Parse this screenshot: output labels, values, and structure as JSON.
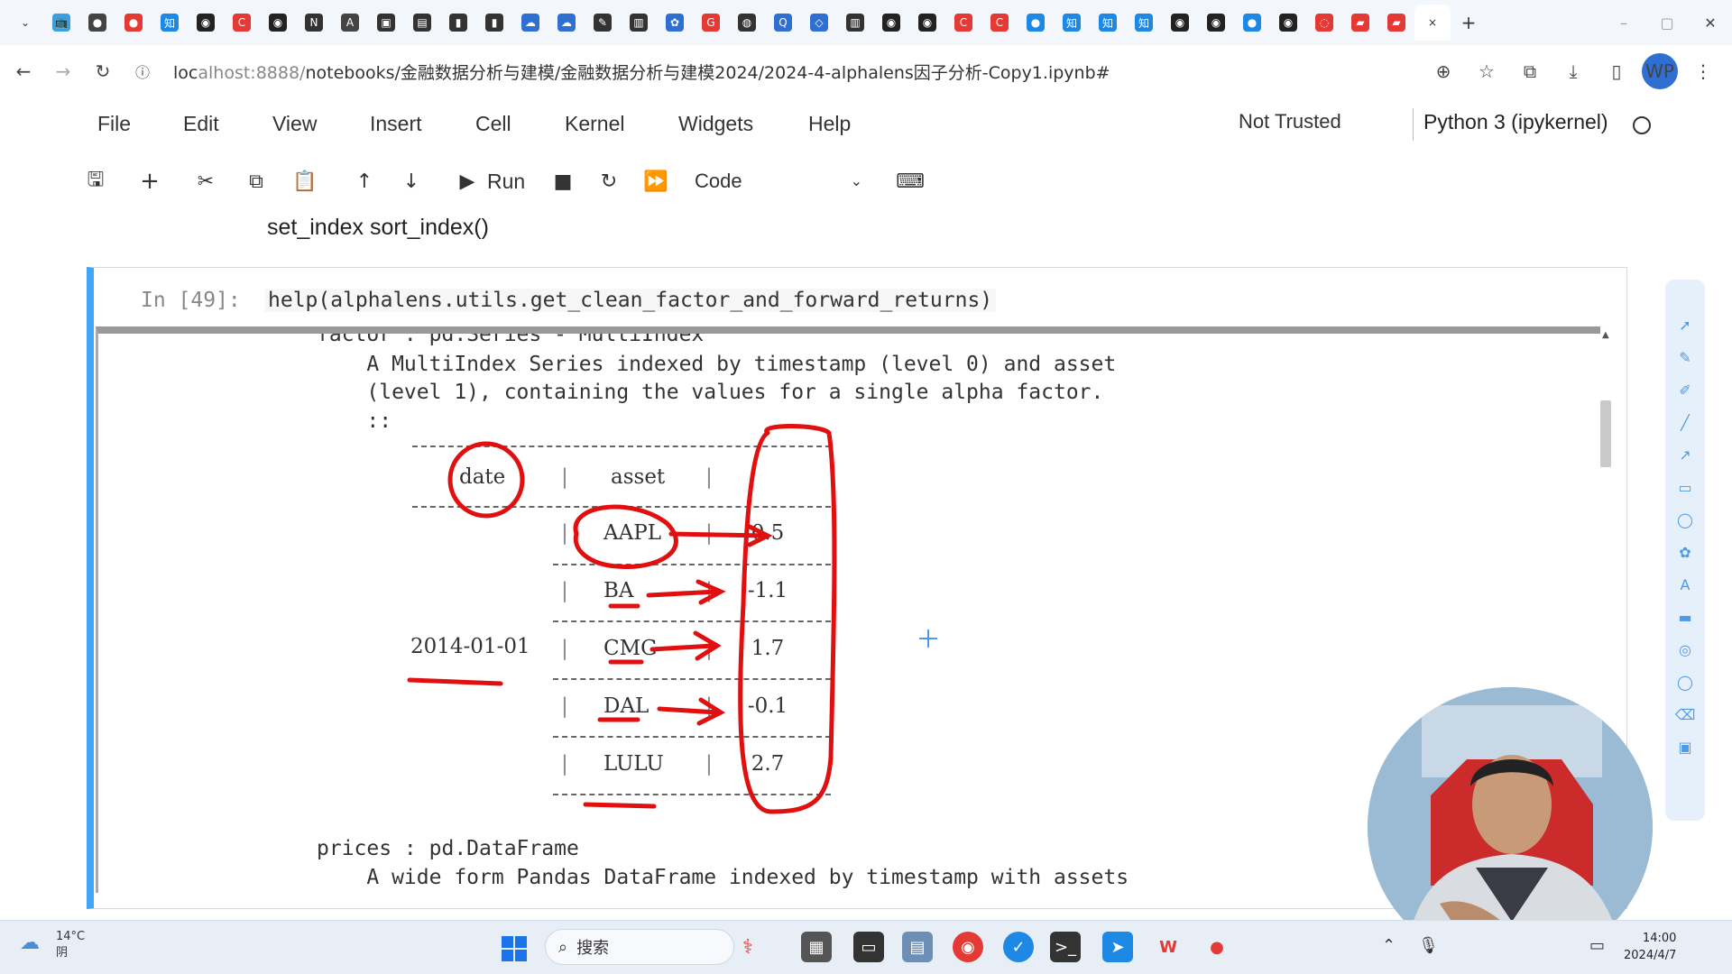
{
  "browser": {
    "tabs": [
      {
        "icon": "bilibili-icon",
        "glyph": "📺",
        "color": "#3b9ede"
      },
      {
        "icon": "chat-icon",
        "glyph": "●",
        "color": "#444444"
      },
      {
        "icon": "record-icon",
        "glyph": "●",
        "color": "#e53935"
      },
      {
        "icon": "zhihu-icon",
        "glyph": "知",
        "color": "#1e88e5"
      },
      {
        "icon": "github-icon",
        "glyph": "◉",
        "color": "#222222"
      },
      {
        "icon": "c-icon",
        "glyph": "C",
        "color": "#e53935"
      },
      {
        "icon": "github-icon",
        "glyph": "◉",
        "color": "#222222"
      },
      {
        "icon": "notion-icon",
        "glyph": "N",
        "color": "#333333"
      },
      {
        "icon": "ai-icon",
        "glyph": "A",
        "color": "#444444"
      },
      {
        "icon": "video-icon",
        "glyph": "▣",
        "color": "#333333"
      },
      {
        "icon": "doc-icon",
        "glyph": "▤",
        "color": "#333333"
      },
      {
        "icon": "terminal-icon",
        "glyph": "▮",
        "color": "#333333"
      },
      {
        "icon": "terminal-icon",
        "glyph": "▮",
        "color": "#333333"
      },
      {
        "icon": "cloud-icon",
        "glyph": "☁",
        "color": "#2f6fd1"
      },
      {
        "icon": "cloud-icon",
        "glyph": "☁",
        "color": "#2f6fd1"
      },
      {
        "icon": "python-icon",
        "glyph": "✎",
        "color": "#333333"
      },
      {
        "icon": "book-icon",
        "glyph": "▥",
        "color": "#333333"
      },
      {
        "icon": "paw-icon",
        "glyph": "✿",
        "color": "#2f6fd1"
      },
      {
        "icon": "google-icon",
        "glyph": "G",
        "color": "#e53935"
      },
      {
        "icon": "globe-icon",
        "glyph": "◍",
        "color": "#333333"
      },
      {
        "icon": "q-icon",
        "glyph": "Q",
        "color": "#2f6fd1"
      },
      {
        "icon": "vscode-icon",
        "glyph": "◇",
        "color": "#2f6fd1"
      },
      {
        "icon": "book-icon",
        "glyph": "▥",
        "color": "#333333"
      },
      {
        "icon": "github-icon",
        "glyph": "◉",
        "color": "#222222"
      },
      {
        "icon": "github-icon",
        "glyph": "◉",
        "color": "#222222"
      },
      {
        "icon": "c-icon",
        "glyph": "C",
        "color": "#e53935"
      },
      {
        "icon": "c-icon",
        "glyph": "C",
        "color": "#e53935"
      },
      {
        "icon": "circle-icon",
        "glyph": "●",
        "color": "#1e88e5"
      },
      {
        "icon": "zhihu-icon",
        "glyph": "知",
        "color": "#1e88e5"
      },
      {
        "icon": "zhihu-icon",
        "glyph": "知",
        "color": "#1e88e5"
      },
      {
        "icon": "zhihu-icon",
        "glyph": "知",
        "color": "#1e88e5"
      },
      {
        "icon": "github-icon",
        "glyph": "◉",
        "color": "#222222"
      },
      {
        "icon": "github-icon",
        "glyph": "◉",
        "color": "#222222"
      },
      {
        "icon": "circle-icon",
        "glyph": "●",
        "color": "#1e88e5"
      },
      {
        "icon": "github-icon",
        "glyph": "◉",
        "color": "#222222"
      },
      {
        "icon": "ring-icon",
        "glyph": "◌",
        "color": "#e53935"
      },
      {
        "icon": "pdf-icon",
        "glyph": "▰",
        "color": "#e53935"
      },
      {
        "icon": "pdf-icon",
        "glyph": "▰",
        "color": "#e53935"
      }
    ],
    "close_tab": "×",
    "new_tab": "+",
    "url_prefix": "loc",
    "url_host": "alhost:8888/",
    "url_path": "notebooks/金融数据分析与建模/金融数据分析与建模2024/2024-4-alphalens因子分析-Copy1.ipynb#",
    "avatar_text": "WP"
  },
  "menu": {
    "items": [
      "File",
      "Edit",
      "View",
      "Insert",
      "Cell",
      "Kernel",
      "Widgets",
      "Help"
    ],
    "trusted": "Not Trusted",
    "kernel": "Python 3 (ipykernel)"
  },
  "toolbar": {
    "run_label": "Run",
    "cell_type": "Code"
  },
  "notebook": {
    "markdown_text": "set_index sort_index()",
    "prompt": "In  [49]:",
    "code": "help(alphalens.utils.get_clean_factor_and_forward_returns)",
    "doc_lines": [
      "factor : pd.Series - MultiIndex",
      "    A MultiIndex Series indexed by timestamp (level 0) and asset",
      "    (level 1), containing the values for a single alpha factor.",
      "    ::"
    ],
    "table_header": {
      "date": "date",
      "asset": "asset"
    },
    "table_date": "2014-01-01",
    "table_rows": [
      {
        "asset": "AAPL",
        "value": "0.5"
      },
      {
        "asset": "BA",
        "value": "-1.1"
      },
      {
        "asset": "CMG",
        "value": "1.7"
      },
      {
        "asset": "DAL",
        "value": "-0.1"
      },
      {
        "asset": "LULU",
        "value": "2.7"
      }
    ],
    "doc_tail": [
      "prices : pd.DataFrame",
      "    A wide form Pandas DataFrame indexed by timestamp with assets"
    ]
  },
  "taskbar": {
    "temp": "14°C",
    "weather": "阴",
    "search": "搜索",
    "time": "14:00",
    "date": "2024/4/7"
  }
}
